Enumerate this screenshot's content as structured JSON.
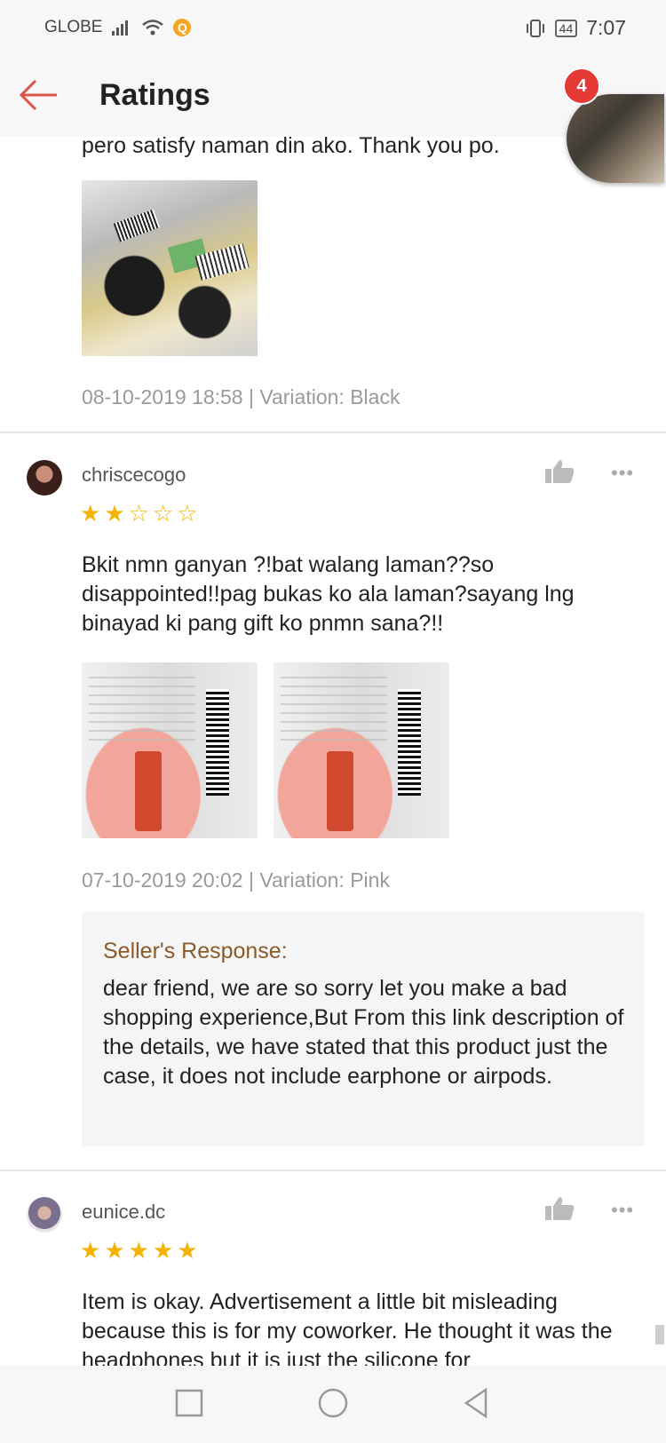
{
  "status_bar": {
    "carrier": "GLOBE",
    "battery": "44",
    "time": "7:07"
  },
  "header": {
    "title": "Ratings"
  },
  "chat_head": {
    "badge_count": "4"
  },
  "reviews": [
    {
      "comment_fragment": "pero satisfy naman din ako. Thank you po.",
      "meta": "08-10-2019 18:58 | Variation: Black"
    },
    {
      "username": "chriscecogo",
      "rating": 2,
      "stars": "★★☆☆☆",
      "comment": "Bkit nmn ganyan ?!bat walang laman??so disappointed!!pag bukas ko ala laman?sayang lng binayad ki pang gift ko pnmn sana?!!",
      "meta": "07-10-2019 20:02 | Variation: Pink",
      "seller_response": {
        "title": "Seller's Response:",
        "text": "dear friend, we are so sorry let you make a bad shopping experience,But From this link description of the details, we have stated that this product just the case, it does not include earphone or airpods."
      }
    },
    {
      "username": "eunice.dc",
      "rating": 5,
      "stars": "★★★★★",
      "comment": "Item is okay. Advertisement a little bit misleading because this is for my coworker. He thought it was the headphones but it is just the silicone for"
    }
  ],
  "more_label": "•••",
  "colors": {
    "accent": "#d9534f",
    "star": "#f5b301",
    "seller_title": "#8a5a2b",
    "badge": "#e53935"
  }
}
